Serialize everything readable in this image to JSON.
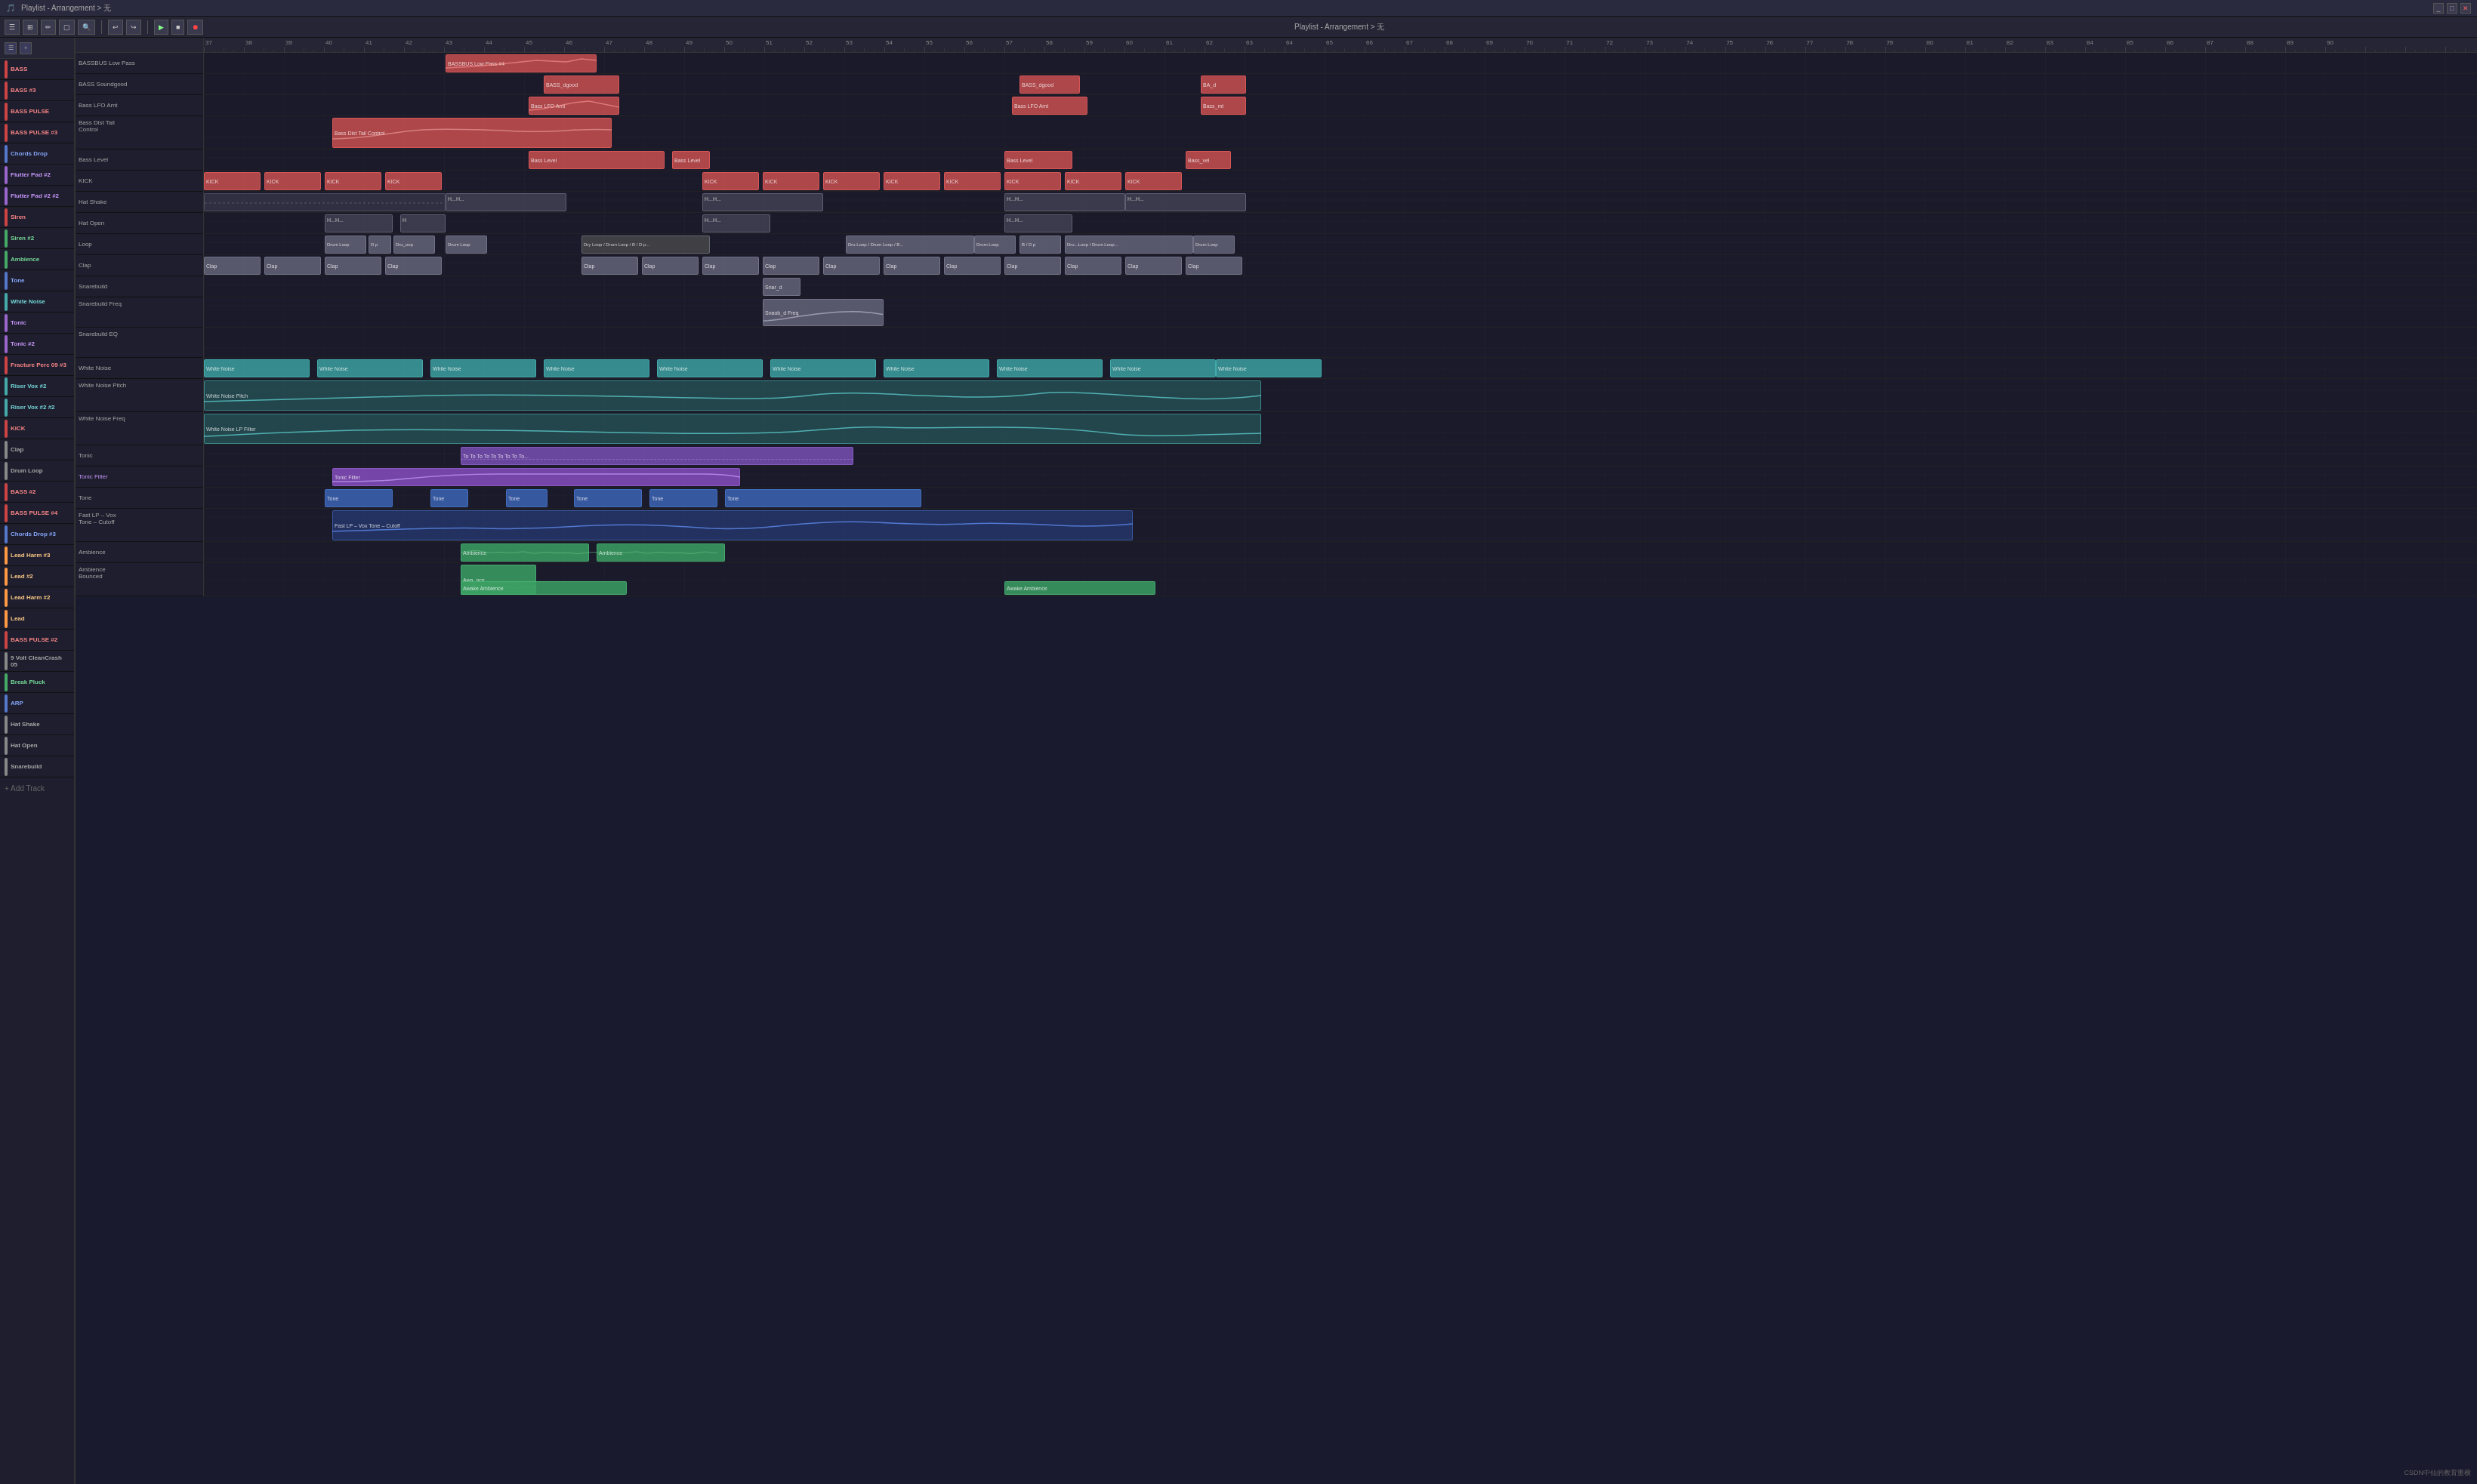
{
  "app": {
    "title": "Playlist - Arrangement > 无",
    "window_buttons": [
      "minimize",
      "maximize",
      "close"
    ]
  },
  "toolbar": {
    "buttons": [
      "menu",
      "snap",
      "pencil",
      "select",
      "zoom",
      "undo",
      "redo",
      "play",
      "stop",
      "record",
      "volume"
    ]
  },
  "ruler": {
    "marks": [
      "37",
      "38",
      "39",
      "40",
      "41",
      "42",
      "43",
      "44",
      "45",
      "46",
      "47",
      "48",
      "49",
      "50",
      "51",
      "52",
      "53",
      "54",
      "55",
      "56",
      "57",
      "58",
      "59",
      "60",
      "61",
      "62",
      "63",
      "64",
      "65",
      "66",
      "67",
      "68",
      "69",
      "70",
      "71",
      "72",
      "73",
      "74",
      "75",
      "76",
      "77",
      "78",
      "79",
      "80",
      "81",
      "82",
      "83",
      "84",
      "85",
      "86",
      "87",
      "88",
      "89",
      "90"
    ]
  },
  "tracks": [
    {
      "id": "bassbus",
      "name": "BASSBUS Low Pass",
      "color": "red",
      "colorHex": "#cc4444"
    },
    {
      "id": "bass3",
      "name": "BASS Soundgood",
      "color": "red",
      "colorHex": "#cc4444"
    },
    {
      "id": "bass_pulse",
      "name": "Bass LFO Amt",
      "color": "red",
      "colorHex": "#cc4444"
    },
    {
      "id": "bass_pulse3",
      "name": "Bass Dist Tail Control",
      "color": "red",
      "colorHex": "#cc4444"
    },
    {
      "id": "chords_drop",
      "name": "Bass Level",
      "color": "red",
      "colorHex": "#cc4444"
    },
    {
      "id": "flutter1",
      "name": "KICK",
      "color": "red",
      "colorHex": "#cc4444"
    },
    {
      "id": "flutter2",
      "name": "Hat Shake",
      "color": "gray",
      "colorHex": "#888888"
    },
    {
      "id": "siren",
      "name": "Hat Open",
      "color": "gray",
      "colorHex": "#888888"
    },
    {
      "id": "siren2",
      "name": "Loop",
      "color": "gray",
      "colorHex": "#888888"
    },
    {
      "id": "ambience",
      "name": "Clap",
      "color": "gray",
      "colorHex": "#888888"
    },
    {
      "id": "tone",
      "name": "Snarebuild",
      "color": "gray",
      "colorHex": "#888888"
    },
    {
      "id": "white_noise",
      "name": "Snarebuild Freq",
      "color": "gray",
      "colorHex": "#888888"
    },
    {
      "id": "tonic",
      "name": "Snarebuild EQ",
      "color": "gray",
      "colorHex": "#888888"
    },
    {
      "id": "tonic2",
      "name": "White Noise",
      "color": "teal",
      "colorHex": "#44aaaa"
    },
    {
      "id": "fracture",
      "name": "White Noise Pitch",
      "color": "teal",
      "colorHex": "#44aaaa"
    },
    {
      "id": "riser_vox",
      "name": "White Noise Freq",
      "color": "teal",
      "colorHex": "#44aaaa"
    },
    {
      "id": "riser_vox2",
      "name": "Tonic",
      "color": "purple",
      "colorHex": "#9966cc"
    },
    {
      "id": "kick",
      "name": "Tonic Filter",
      "color": "purple",
      "colorHex": "#9966cc"
    },
    {
      "id": "clap",
      "name": "Tone",
      "color": "blue",
      "colorHex": "#5577cc"
    },
    {
      "id": "drum_loop",
      "name": "Fast LP - Vox Tone - Cutoff",
      "color": "blue",
      "colorHex": "#5577cc"
    },
    {
      "id": "bass2",
      "name": "Ambience",
      "color": "green",
      "colorHex": "#44aa66"
    },
    {
      "id": "bass_pulse4",
      "name": "Ambience Bounced",
      "color": "green",
      "colorHex": "#44aa66"
    }
  ],
  "left_tracks": [
    {
      "name": "BASS",
      "color": "#cc4444"
    },
    {
      "name": "BASS #3",
      "color": "#cc4444"
    },
    {
      "name": "BASS PULSE",
      "color": "#cc4444"
    },
    {
      "name": "BASS PULSE #3",
      "color": "#cc4444"
    },
    {
      "name": "Chords Drop",
      "color": "#5577cc"
    },
    {
      "name": "Flutter Pad #2",
      "color": "#9966cc"
    },
    {
      "name": "Flutter Pad #2 #2",
      "color": "#9966cc"
    },
    {
      "name": "Siren",
      "color": "#cc4444"
    },
    {
      "name": "Siren #2",
      "color": "#44aa66"
    },
    {
      "name": "Ambience",
      "color": "#44aa66"
    },
    {
      "name": "Tone",
      "color": "#5577cc"
    },
    {
      "name": "White Noise",
      "color": "#44aaaa"
    },
    {
      "name": "Tonic",
      "color": "#9966cc"
    },
    {
      "name": "Tonic #2",
      "color": "#9966cc"
    },
    {
      "name": "Fracture Perc 09 #3",
      "color": "#cc4444"
    },
    {
      "name": "Riser Vox #2",
      "color": "#44aaaa"
    },
    {
      "name": "Riser Vox #2 #2",
      "color": "#44aaaa"
    },
    {
      "name": "KICK",
      "color": "#cc4444"
    },
    {
      "name": "Clap",
      "color": "#888888"
    },
    {
      "name": "Drum Loop",
      "color": "#888888"
    },
    {
      "name": "BASS #2",
      "color": "#cc4444"
    },
    {
      "name": "BASS PULSE #4",
      "color": "#cc4444"
    },
    {
      "name": "Chords Drop #3",
      "color": "#5577cc"
    },
    {
      "name": "Lead Harm #3",
      "color": "#ffaa44"
    },
    {
      "name": "Lead #2",
      "color": "#ffaa44"
    },
    {
      "name": "Lead Harm #2",
      "color": "#ffaa44"
    },
    {
      "name": "Lead",
      "color": "#ffaa44"
    },
    {
      "name": "BASS PULSE #2",
      "color": "#cc4444"
    },
    {
      "name": "9 Volt CleanCrash 05",
      "color": "#888888"
    },
    {
      "name": "Break Pluck",
      "color": "#44aa66"
    },
    {
      "name": "ARP",
      "color": "#5577cc"
    },
    {
      "name": "Hat Shake",
      "color": "#888888"
    },
    {
      "name": "Hat Open",
      "color": "#888888"
    },
    {
      "name": "Snarebuild",
      "color": "#888888"
    }
  ],
  "colors": {
    "bg_dark": "#1a1a2a",
    "bg_medium": "#1e1e2e",
    "bg_light": "#252535",
    "border": "#333333",
    "text": "#cccccc",
    "accent_red": "#cc4444",
    "accent_green": "#44aa66",
    "accent_blue": "#5577cc",
    "accent_purple": "#9966cc",
    "accent_teal": "#44aaaa",
    "accent_orange": "#ff9944"
  }
}
